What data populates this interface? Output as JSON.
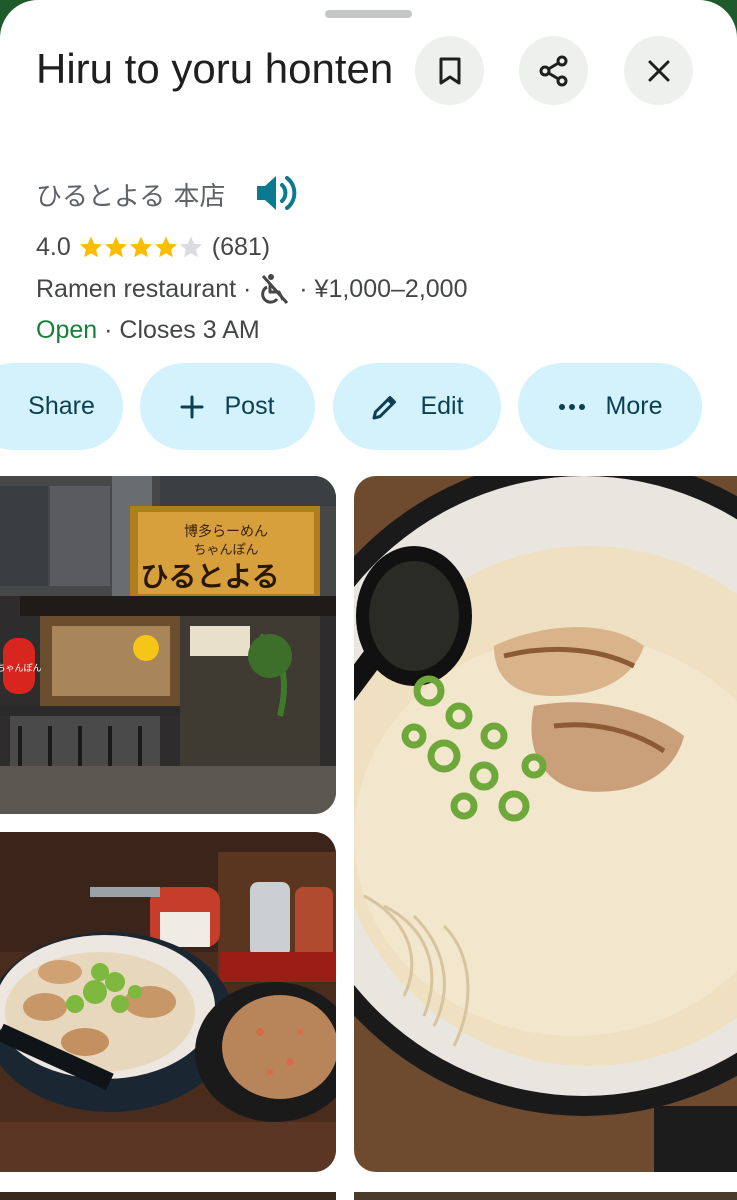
{
  "place": {
    "title": "Hiru to yoru honten",
    "alt_name": "ひるとよる 本店",
    "rating": "4.0",
    "rating_value": 4.0,
    "review_count": "(681)",
    "category": "Ramen restaurant",
    "separator": " · ",
    "price_range": "¥1,000–2,000",
    "open_status": "Open",
    "hours_text": "Closes 3 AM"
  },
  "actions": {
    "share": "Share",
    "post": "Post",
    "edit": "Edit",
    "more": "More"
  },
  "photos": {
    "storefront_sign_line1": "博多らーめん",
    "storefront_sign_line2": "ちゃんぽん",
    "storefront_sign_main": "ひるとよる",
    "lantern_text": "ちゃんぽん"
  },
  "colors": {
    "star": "#fbbc04",
    "star_empty": "#dadce0",
    "open": "#188038",
    "chip_bg": "#d3f2fb",
    "speaker": "#0b7a8f"
  },
  "icons": {
    "save": "bookmark-icon",
    "share": "share-icon",
    "close": "close-icon",
    "audio": "speaker-icon",
    "accessibility": "no-wheelchair-icon",
    "post": "plus-icon",
    "edit": "pencil-icon",
    "more": "more-dots-icon"
  }
}
